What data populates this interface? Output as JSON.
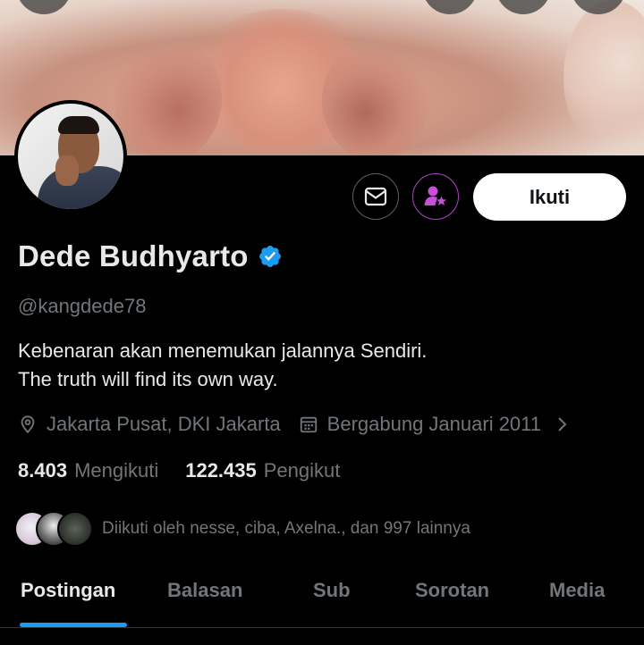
{
  "profile": {
    "name": "Dede Budhyarto",
    "handle": "@kangdede78",
    "bio_line1": "Kebenaran akan menemukan jalannya Sendiri.",
    "bio_line2": "The truth will find its own way.",
    "location": "Jakarta Pusat, DKI Jakarta",
    "joined": "Bergabung Januari 2011",
    "verified": true
  },
  "actions": {
    "message_icon": "mail-icon",
    "subscribe_icon": "subscribe-star-icon",
    "follow_label": "Ikuti"
  },
  "stats": {
    "following_count": "8.403",
    "following_label": "Mengikuti",
    "followers_count": "122.435",
    "followers_label": "Pengikut"
  },
  "followed_by": {
    "text": "Diikuti oleh nesse, ciba, Axelna., dan 997 lainnya"
  },
  "tabs": [
    {
      "label": "Postingan",
      "active": true
    },
    {
      "label": "Balasan",
      "active": false
    },
    {
      "label": "Sub",
      "active": false
    },
    {
      "label": "Sorotan",
      "active": false
    },
    {
      "label": "Media",
      "active": false
    }
  ],
  "colors": {
    "accent": "#1d9bf0",
    "subscribe_border": "#b141c8",
    "subscribe_icon": "#c94fd8",
    "text_primary": "#e7e9ea",
    "text_secondary": "#71767b",
    "background": "#000000"
  }
}
